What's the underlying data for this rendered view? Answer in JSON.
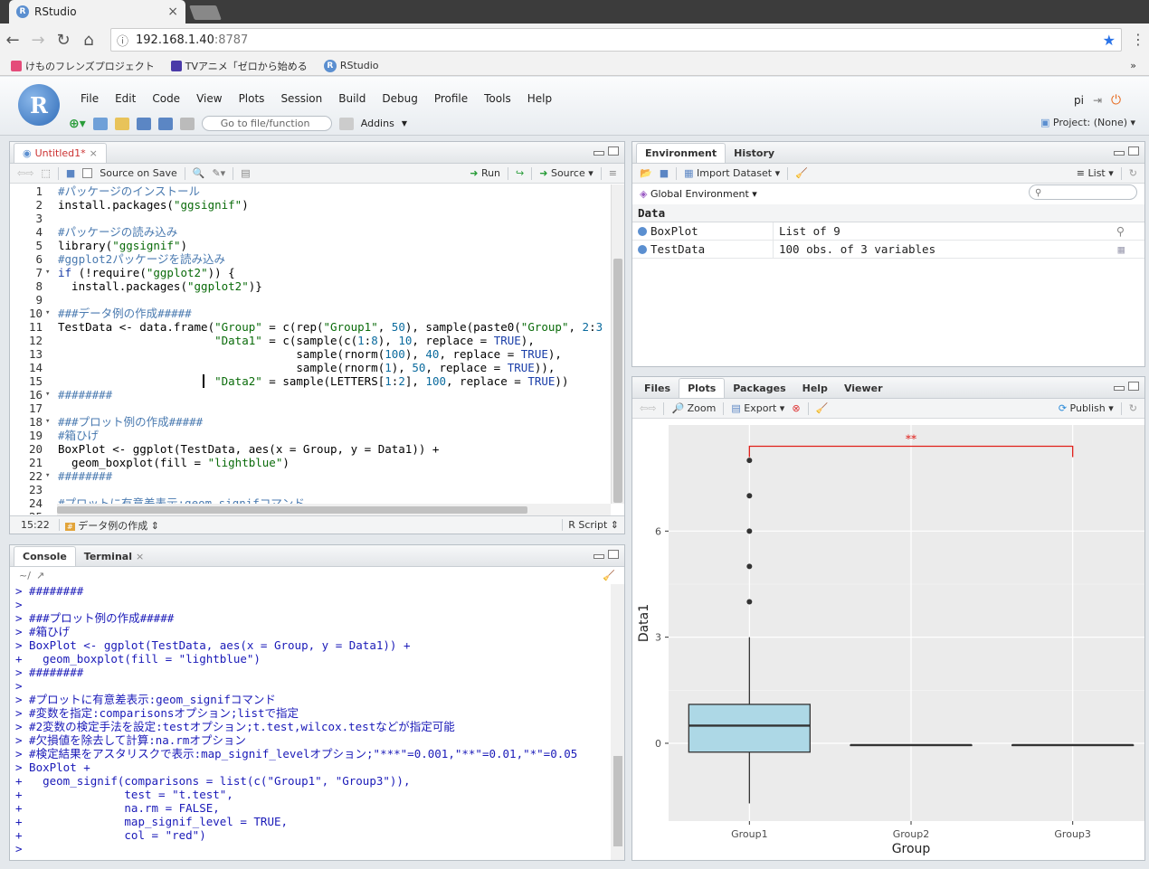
{
  "browser": {
    "tab_title": "RStudio",
    "url_host": "192.168.1.40",
    "url_port": ":8787",
    "bookmarks": [
      "けものフレンズプロジェクト",
      "TVアニメ「ゼロから始める",
      "RStudio"
    ]
  },
  "menu": [
    "File",
    "Edit",
    "Code",
    "View",
    "Plots",
    "Session",
    "Build",
    "Debug",
    "Profile",
    "Tools",
    "Help"
  ],
  "toolbar": {
    "goto_placeholder": "Go to file/function",
    "addins": "Addins"
  },
  "user": {
    "name": "pi",
    "project": "Project: (None)"
  },
  "editor": {
    "tab": "Untitled1*",
    "source_on_save": "Source on Save",
    "run": "Run",
    "source": "Source",
    "cursor_pos": "15:22",
    "section": "データ例の作成",
    "file_type": "R Script",
    "lines": [
      "#パッケージのインストール",
      "install.packages(\"ggsignif\")",
      "",
      "#パッケージの読み込み",
      "library(\"ggsignif\")",
      "#ggplot2パッケージを読み込み",
      "if (!require(\"ggplot2\")) {",
      "  install.packages(\"ggplot2\")}",
      "",
      "###データ例の作成#####",
      "TestData <- data.frame(\"Group\" = c(rep(\"Group1\", 50), sample(paste0(\"Group\", 2:3",
      "                       \"Data1\" = c(sample(c(1:8), 10, replace = TRUE),",
      "                                   sample(rnorm(100), 40, replace = TRUE),",
      "                                   sample(rnorm(1), 50, replace = TRUE)),",
      "                       \"Data2\" = sample(LETTERS[1:2], 100, replace = TRUE))",
      "########",
      "",
      "###プロット例の作成#####",
      "#箱ひげ",
      "BoxPlot <- ggplot(TestData, aes(x = Group, y = Data1)) +",
      "  geom_boxplot(fill = \"lightblue\")",
      "########",
      "",
      "#プロットに有意差表示:geom_signifコマンド",
      ""
    ]
  },
  "console": {
    "tabs": [
      "Console",
      "Terminal"
    ],
    "path": "~/",
    "lines": [
      "> ########",
      ">",
      "> ###プロット例の作成#####",
      "> #箱ひげ",
      "> BoxPlot <- ggplot(TestData, aes(x = Group, y = Data1)) +",
      "+   geom_boxplot(fill = \"lightblue\")",
      "> ########",
      ">",
      "> #プロットに有意差表示:geom_signifコマンド",
      "> #変数を指定:comparisonsオプション;listで指定",
      "> #2変数の検定手法を設定:testオプション;t.test,wilcox.testなどが指定可能",
      "> #欠損値を除去して計算:na.rmオプション",
      "> #検定結果をアスタリスクで表示:map_signif_levelオプション;\"***\"=0.001,\"**\"=0.01,\"*\"=0.05",
      "> BoxPlot +",
      "+   geom_signif(comparisons = list(c(\"Group1\", \"Group3\")),",
      "+               test = \"t.test\",",
      "+               na.rm = FALSE,",
      "+               map_signif_level = TRUE,",
      "+               col = \"red\")",
      "> "
    ]
  },
  "environment": {
    "tabs": [
      "Environment",
      "History"
    ],
    "import": "Import Dataset",
    "view": "List",
    "scope": "Global Environment",
    "section": "Data",
    "rows": [
      {
        "name": "BoxPlot",
        "value": "List of 9"
      },
      {
        "name": "TestData",
        "value": "100 obs. of 3 variables"
      }
    ]
  },
  "plots_pane": {
    "tabs": [
      "Files",
      "Plots",
      "Packages",
      "Help",
      "Viewer"
    ],
    "zoom": "Zoom",
    "export": "Export",
    "publish": "Publish"
  },
  "chart_data": {
    "type": "box",
    "categories": [
      "Group1",
      "Group2",
      "Group3"
    ],
    "xlabel": "Group",
    "ylabel": "Data1",
    "yticks": [
      0,
      3,
      6
    ],
    "ylim": [
      -2.2,
      9
    ],
    "boxes": [
      {
        "q1": -0.25,
        "median": 0.5,
        "q3": 1.1,
        "lower": -1.7,
        "upper": 3.0,
        "outliers": [
          4,
          5,
          6,
          7,
          8
        ]
      },
      {
        "q1": -0.05,
        "median": -0.05,
        "q3": -0.05,
        "lower": -0.05,
        "upper": -0.05,
        "outliers": []
      },
      {
        "q1": -0.05,
        "median": -0.05,
        "q3": -0.05,
        "lower": -0.05,
        "upper": -0.05,
        "outliers": []
      }
    ],
    "box_fill": "#add8e6",
    "signif": {
      "from": "Group1",
      "to": "Group3",
      "label": "**",
      "y": 8.4,
      "color": "#e0201b"
    }
  }
}
